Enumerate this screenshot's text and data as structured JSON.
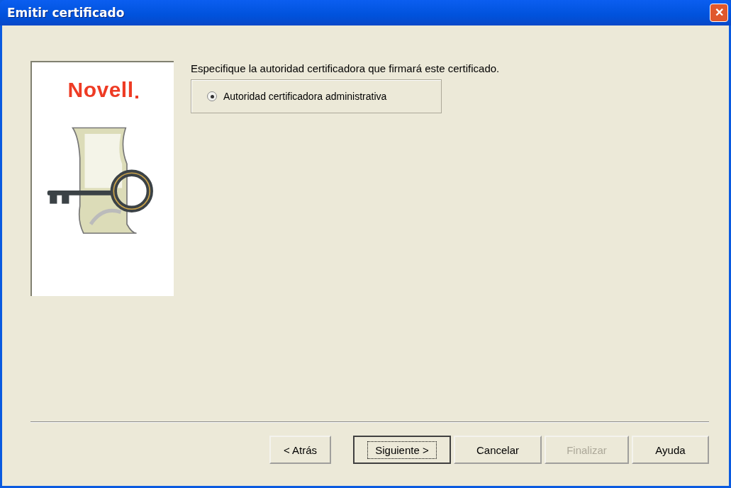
{
  "window": {
    "title": "Emitir certificado",
    "close_glyph": "✕"
  },
  "logo": "Novell",
  "prompt": "Especifique la autoridad certificadora que firmará este certificado.",
  "options": [
    {
      "label": "Autoridad certificadora administrativa",
      "selected": true
    }
  ],
  "buttons": [
    {
      "label": "< Atrás",
      "disabled": false,
      "default": false
    },
    {
      "label": "Siguiente >",
      "disabled": false,
      "default": true
    },
    {
      "label": "Cancelar",
      "disabled": false,
      "default": false
    },
    {
      "label": "Finalizar",
      "disabled": true,
      "default": false
    },
    {
      "label": "Ayuda",
      "disabled": false,
      "default": false
    }
  ]
}
